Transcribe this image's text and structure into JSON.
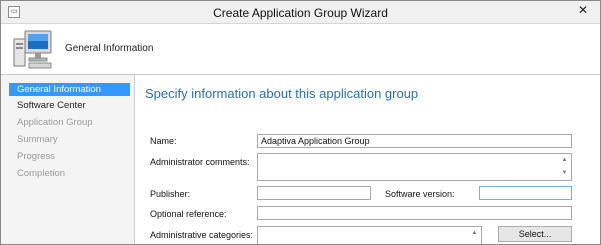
{
  "window": {
    "title": "Create Application Group Wizard",
    "close_glyph": "✕",
    "system_icon": "wizard-window-icon"
  },
  "header": {
    "title": "General Information",
    "icon": "computer-monitor-icon"
  },
  "sidebar": {
    "items": [
      {
        "label": "General Information",
        "state": "current"
      },
      {
        "label": "Software Center",
        "state": "done"
      },
      {
        "label": "Application Group",
        "state": "pending"
      },
      {
        "label": "Summary",
        "state": "pending"
      },
      {
        "label": "Progress",
        "state": "pending"
      },
      {
        "label": "Completion",
        "state": "pending"
      }
    ]
  },
  "main": {
    "heading": "Specify information about this application group",
    "fields": {
      "name_label": "Name:",
      "name_value": "Adaptiva Application Group",
      "admin_comments_label": "Administrator comments:",
      "admin_comments_value": "",
      "publisher_label": "Publisher:",
      "publisher_value": "",
      "software_version_label": "Software version:",
      "software_version_value": "",
      "optional_reference_label": "Optional reference:",
      "optional_reference_value": "",
      "admin_categories_label": "Administrative categories:",
      "admin_categories_value": ""
    },
    "select_button": "Select..."
  },
  "colors": {
    "selected_nav_bg": "#3399ff",
    "heading_blue": "#2a6fb5",
    "focus_border": "#7ab1dc"
  }
}
